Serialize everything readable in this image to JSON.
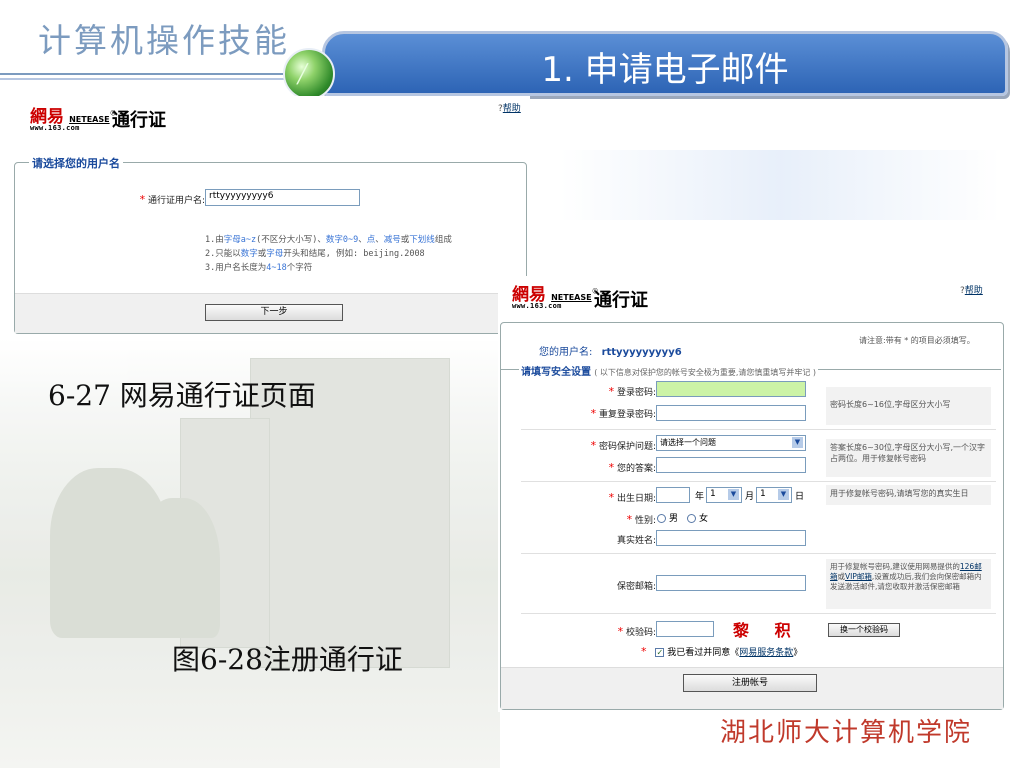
{
  "slide": {
    "category": "计算机操作技能",
    "title": "1. 申请电子邮件",
    "school": "湖北师大计算机学院"
  },
  "captions": {
    "fig1": "6-27 网易通行证页面",
    "fig2": "图6-28注册通行证"
  },
  "logo": {
    "cn": "網易",
    "netease": "NETEASE",
    "url": "www.163.com",
    "pass": "通行证",
    "reg_mark": "®"
  },
  "help_label": "帮助",
  "shot1": {
    "legend": "请选择您的用户名",
    "username_label": "通行证用户名:",
    "username_value": "rttyyyyyyyyy6",
    "rules": [
      {
        "pre": "1.由",
        "a": "字母a~z",
        "b": "(不区分大小写)、",
        "c": "数字0~9",
        "d": "、",
        "e": "点",
        "f": "、",
        "g": "减号",
        "h": "或",
        "i": "下划线",
        "j": "组成"
      },
      {
        "pre": "2.只能以",
        "a": "数字",
        "b": "或",
        "c": "字母",
        "d": "开头和结尾, 例如: beijing.2008"
      },
      {
        "pre": "3.用户名长度为",
        "a": "4~18",
        "b": "个字符"
      }
    ],
    "next_button": "下一步"
  },
  "shot2": {
    "your_username_label": "您的用户名:",
    "your_username_value": "rttyyyyyyyyy6",
    "notice": "请注意:带有 * 的项目必须填写。",
    "section_title": "请填写安全设置",
    "section_note": "( 以下信息对保护您的帐号安全极为重要,请您慎重填写并牢记 )",
    "login_password_label": "登录密码:",
    "repeat_password_label": "重复登录密码:",
    "password_tip": "密码长度6~16位,字母区分大小写",
    "question_label": "密码保护问题:",
    "question_select": "请选择一个问题",
    "answer_label": "您的答案:",
    "answer_tip": "答案长度6~30位,字母区分大小写,一个汉字占两位。用于修复帐号密码",
    "birthday_label": "出生日期:",
    "year_unit": "年",
    "month_value": "1",
    "month_unit": "月",
    "day_value": "1",
    "day_unit": "日",
    "birthday_tip": "用于修复帐号密码,请填写您的真实生日",
    "gender_label": "性别:",
    "gender_male": "男",
    "gender_female": "女",
    "realname_label": "真实姓名:",
    "email_label": "保密邮箱:",
    "email_tip_pre": "用于修复帐号密码,建议使用网易提供的",
    "email_tip_link1": "126邮箱",
    "email_tip_mid": "或",
    "email_tip_link2": "VIP邮箱",
    "email_tip_post": ",设置成功后,我们会向保密邮箱内发送激活邮件,请您收取并激活保密邮箱",
    "captcha_label": "校验码:",
    "captcha_image": "黎 积",
    "captcha_change": "换一个校验码",
    "agree_pre": "我已看过并同意《",
    "agree_link": "网易服务条款",
    "agree_post": "》",
    "register_button": "注册帐号"
  },
  "colors": {
    "title_bar": "#2d64b5",
    "category_text": "#7c9bbf",
    "school_text": "#c0392b",
    "required_star": "#e00000",
    "password_focus": "#ccf3a6"
  }
}
